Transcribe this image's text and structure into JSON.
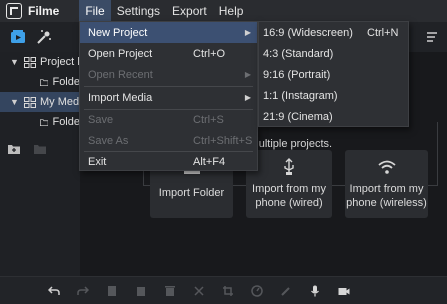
{
  "app": {
    "name": "Filme"
  },
  "menubar": [
    "File",
    "Settings",
    "Export",
    "Help"
  ],
  "tree": {
    "items": [
      {
        "label": "Project l",
        "expanded": true
      },
      {
        "label": "Folde"
      },
      {
        "label": "My Med",
        "expanded": true,
        "selected": true
      },
      {
        "label": "Folde"
      }
    ]
  },
  "main": {
    "drop_text": "and apply it to multiple projects.",
    "cards": [
      {
        "label": "Import Folder",
        "icon": "folder-icon"
      },
      {
        "label": "Import from my phone (wired)",
        "icon": "usb-icon"
      },
      {
        "label": "Import from my phone (wireless)",
        "icon": "wifi-icon"
      }
    ]
  },
  "file_menu": {
    "items": [
      {
        "label": "New Project",
        "shortcut": "",
        "submenu": true,
        "highlight": true
      },
      {
        "label": "Open Project",
        "shortcut": "Ctrl+O"
      },
      {
        "label": "Open Recent",
        "shortcut": "",
        "submenu": true,
        "disabled": true
      },
      {
        "label": "Import Media",
        "shortcut": "",
        "submenu": true
      },
      {
        "label": "Save",
        "shortcut": "Ctrl+S",
        "disabled": true
      },
      {
        "label": "Save As",
        "shortcut": "Ctrl+Shift+S",
        "disabled": true
      },
      {
        "label": "Exit",
        "shortcut": "Alt+F4"
      }
    ]
  },
  "new_project_submenu": {
    "items": [
      {
        "label": "16:9 (Widescreen)",
        "shortcut": "Ctrl+N"
      },
      {
        "label": "4:3 (Standard)",
        "shortcut": ""
      },
      {
        "label": "9:16 (Portrait)",
        "shortcut": ""
      },
      {
        "label": "1:1 (Instagram)",
        "shortcut": ""
      },
      {
        "label": "21:9 (Cinema)",
        "shortcut": ""
      }
    ]
  },
  "colors": {
    "accent": "#3c5072",
    "tree_selected": "#34455f",
    "icon_blue": "#3ea0e8"
  }
}
